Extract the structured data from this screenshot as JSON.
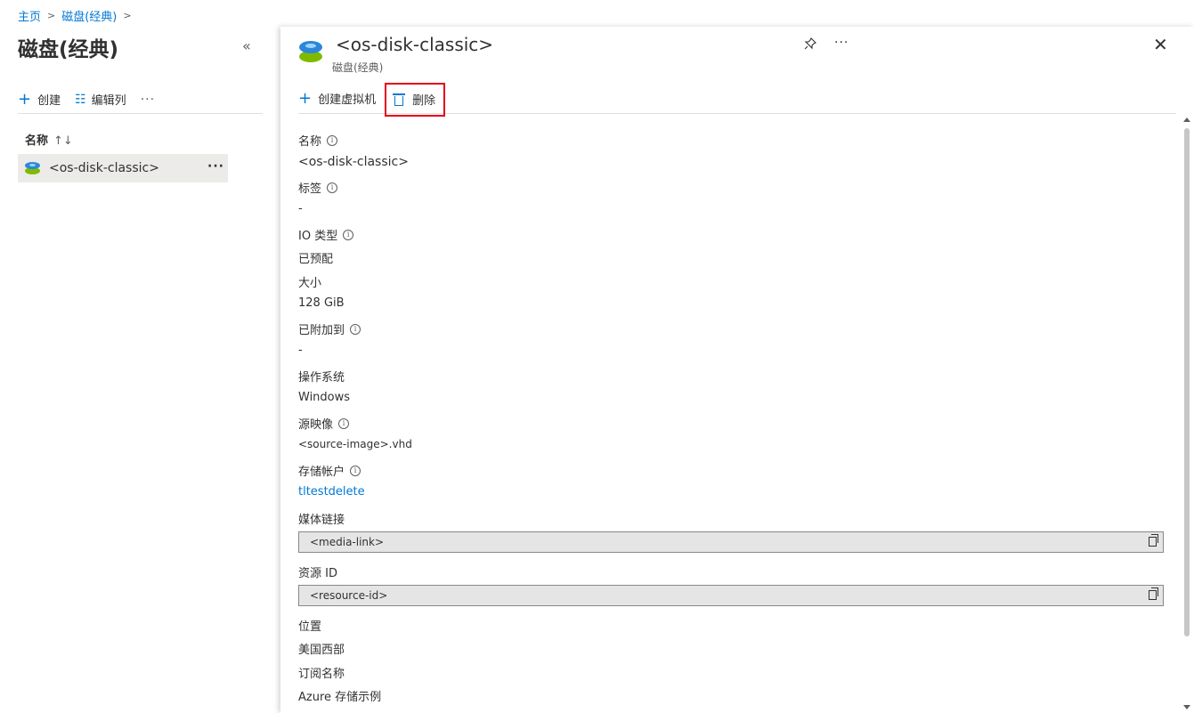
{
  "breadcrumb": {
    "home": "主页",
    "current": "磁盘(经典)"
  },
  "left": {
    "title": "磁盘(经典)",
    "collapse": "«",
    "toolbar": {
      "create": "创建",
      "edit_columns": "编辑列",
      "more": "···"
    },
    "list_header": {
      "name": "名称",
      "sort": "↑↓"
    },
    "items": [
      {
        "name": "<os-disk-classic>",
        "more": "···"
      }
    ]
  },
  "panel": {
    "title": "<os-disk-classic>",
    "subtitle": "磁盘(经典)",
    "more": "···",
    "close": "✕",
    "toolbar": {
      "create_vm": "创建虚拟机",
      "delete": "删除"
    },
    "properties": {
      "name": {
        "label": "名称",
        "value": "<os-disk-classic>"
      },
      "tags": {
        "label": "标签",
        "value": "-"
      },
      "io_type": {
        "label": "IO 类型",
        "value": "已预配"
      },
      "size": {
        "label": "大小",
        "value": "128 GiB"
      },
      "attached_to": {
        "label": "已附加到",
        "value": "-"
      },
      "os": {
        "label": "操作系统",
        "value": "Windows"
      },
      "source_image": {
        "label": "源映像",
        "value": "<source-image>.vhd"
      },
      "storage_account": {
        "label": "存储帐户",
        "value": "tltestdelete"
      },
      "media_link": {
        "label": "媒体链接",
        "value": "<media-link>"
      },
      "resource_id": {
        "label": "资源 ID",
        "value": "<resource-id>"
      },
      "location": {
        "label": "位置",
        "value": "美国西部"
      },
      "subscription": {
        "label": "订阅名称",
        "value": "Azure 存储示例"
      }
    }
  },
  "colors": {
    "accent": "#0078d4",
    "highlight_border": "#e3001b",
    "disk_blue": "#2b88d8",
    "disk_green": "#7fba00"
  }
}
